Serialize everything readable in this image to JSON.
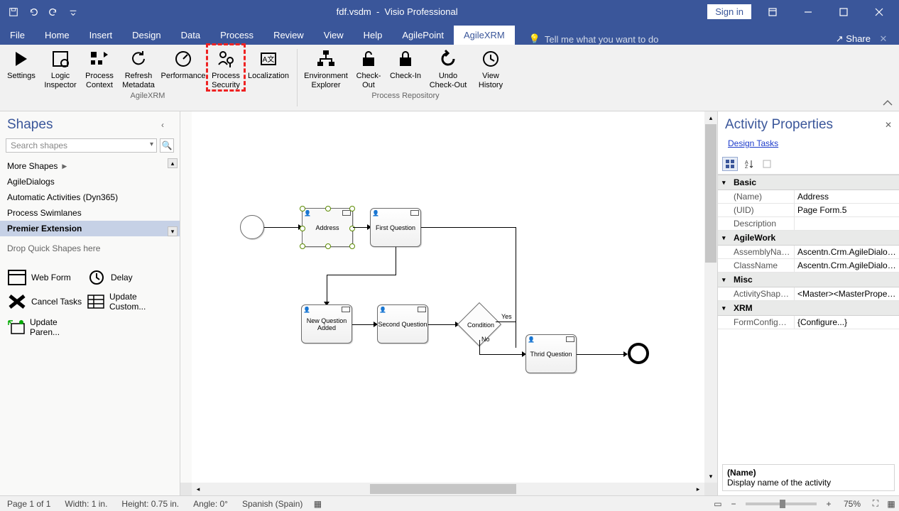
{
  "titlebar": {
    "document": "fdf.vsdm",
    "app": "Visio Professional",
    "signin": "Sign in"
  },
  "menu": {
    "tabs": [
      "File",
      "Home",
      "Insert",
      "Design",
      "Data",
      "Process",
      "Review",
      "View",
      "Help",
      "AgilePoint",
      "AgileXRM"
    ],
    "active": "AgileXRM",
    "tellme": "Tell me what you want to do",
    "share": "Share"
  },
  "ribbon": {
    "group1_label": "AgileXRM",
    "group2_label": "Process Repository",
    "buttons1": [
      {
        "label": "Settings"
      },
      {
        "label": "Logic Inspector"
      },
      {
        "label": "Process Context"
      },
      {
        "label": "Refresh Metadata"
      },
      {
        "label": "Performance"
      },
      {
        "label": "Process Security"
      },
      {
        "label": "Localization"
      }
    ],
    "buttons2": [
      {
        "label": "Environment Explorer"
      },
      {
        "label": "Check-Out"
      },
      {
        "label": "Check-In"
      },
      {
        "label": "Undo Check-Out"
      },
      {
        "label": "View History"
      }
    ]
  },
  "shapes": {
    "title": "Shapes",
    "search_placeholder": "Search shapes",
    "more": "More Shapes",
    "stencils": [
      "AgileDialogs",
      "Automatic Activities (Dyn365)",
      "Process Swimlanes",
      "Premier Extension"
    ],
    "selected_stencil": "Premier Extension",
    "drop_hint": "Drop Quick Shapes here",
    "items": [
      {
        "label": "Web Form"
      },
      {
        "label": "Delay"
      },
      {
        "label": "Cancel Tasks"
      },
      {
        "label": "Update Custom..."
      },
      {
        "label": "Update Paren..."
      }
    ]
  },
  "diagram": {
    "address": "Address",
    "first": "First Question",
    "newq": "New Question Added",
    "second": "Second Question",
    "cond": "Condition",
    "yes": "Yes",
    "no": "No",
    "third": "Thrid Question"
  },
  "props": {
    "title": "Activity Properties",
    "link": "Design Tasks",
    "cats": {
      "basic": "Basic",
      "agile": "AgileWork",
      "misc": "Misc",
      "xrm": "XRM"
    },
    "rows": {
      "name_k": "(Name)",
      "name_v": "Address",
      "uid_k": "(UID)",
      "uid_v": "Page Form.5",
      "desc_k": "Description",
      "desc_v": "",
      "asm_k": "AssemblyName",
      "asm_v": "Ascentn.Crm.AgileDialogsActivity",
      "cls_k": "ClassName",
      "cls_v": "Ascentn.Crm.AgileDialogsActivity",
      "shp_k": "ActivityShapeProperties",
      "shp_v": "<Master><MasterProperties>",
      "frm_k": "FormConfiguration",
      "frm_v": "{Configure...}"
    },
    "desc_title": "(Name)",
    "desc_text": "Display name of the activity"
  },
  "status": {
    "page": "Page 1 of 1",
    "width": "Width: 1 in.",
    "height": "Height: 0.75 in.",
    "angle": "Angle: 0°",
    "lang": "Spanish (Spain)",
    "zoom": "75%"
  }
}
